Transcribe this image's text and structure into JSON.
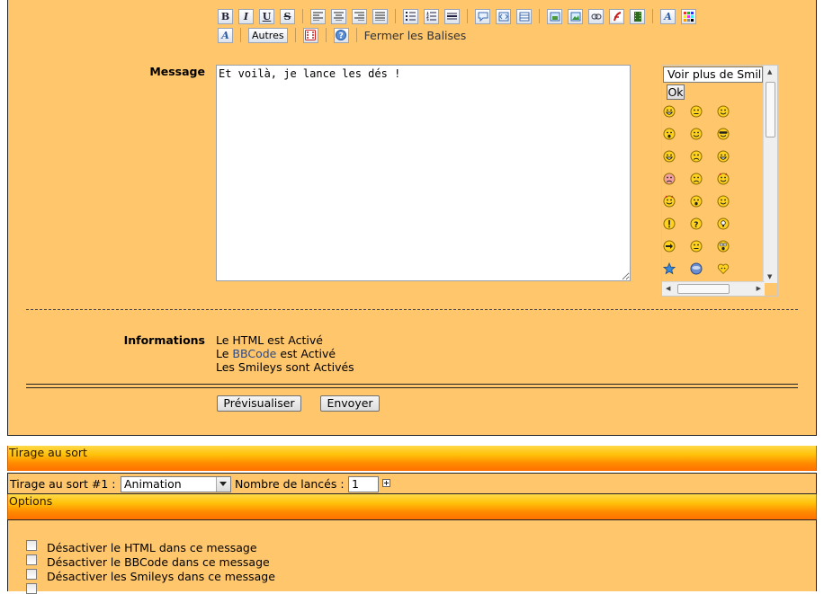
{
  "toolbar": {
    "autres_label": "Autres",
    "fermer_label": "Fermer les Balises",
    "row1": [
      "bold-icon",
      "italic-icon",
      "underline-icon",
      "strikethrough-icon",
      "align-left-icon",
      "align-center-icon",
      "align-right-icon",
      "align-justify-icon",
      "list-bullets-icon",
      "list-numbers-icon",
      "horizontal-rule-icon",
      "quote-icon",
      "code-icon",
      "table-icon",
      "upload-image-icon",
      "image-icon",
      "link-icon",
      "flash-icon",
      "video-icon",
      "font-size-icon",
      "color-palette-icon"
    ],
    "row2": [
      "font-face-icon",
      "dice-icon",
      "help-icon"
    ]
  },
  "message": {
    "label": "Message",
    "text": "Et voilà, je lance les dés !"
  },
  "smileys": {
    "select_value": "Voir plus de Smileys",
    "ok_label": "Ok",
    "icons": [
      "grin",
      "neutral-smile",
      "wink-tongue",
      "surprised",
      "rolling-eyes",
      "cool",
      "big-smile",
      "confused",
      "laughing",
      "blush-sad",
      "sad",
      "angry-devil",
      "devil",
      "dizzy",
      "smile",
      "exclamation",
      "question",
      "idea",
      "arrow",
      "neutral",
      "shocked",
      "star",
      "alien",
      "heart"
    ]
  },
  "informations": {
    "label": "Informations",
    "line1": "Le HTML est Activé",
    "line2_pre": "Le",
    "line2_link": "BBCode",
    "line2_post": "est Activé",
    "line3": "Les Smileys sont Activés"
  },
  "buttons": {
    "preview": "Prévisualiser",
    "send": "Envoyer"
  },
  "tirage": {
    "header": "Tirage au sort",
    "label": "Tirage au sort #1 :",
    "select_value": "Animation",
    "lances_label": "Nombre de lancés :",
    "lances_value": "1"
  },
  "options": {
    "header": "Options",
    "items": [
      "Désactiver le HTML dans ce message",
      "Désactiver le BBCode dans ce message",
      "Désactiver les Smileys dans ce message"
    ]
  }
}
